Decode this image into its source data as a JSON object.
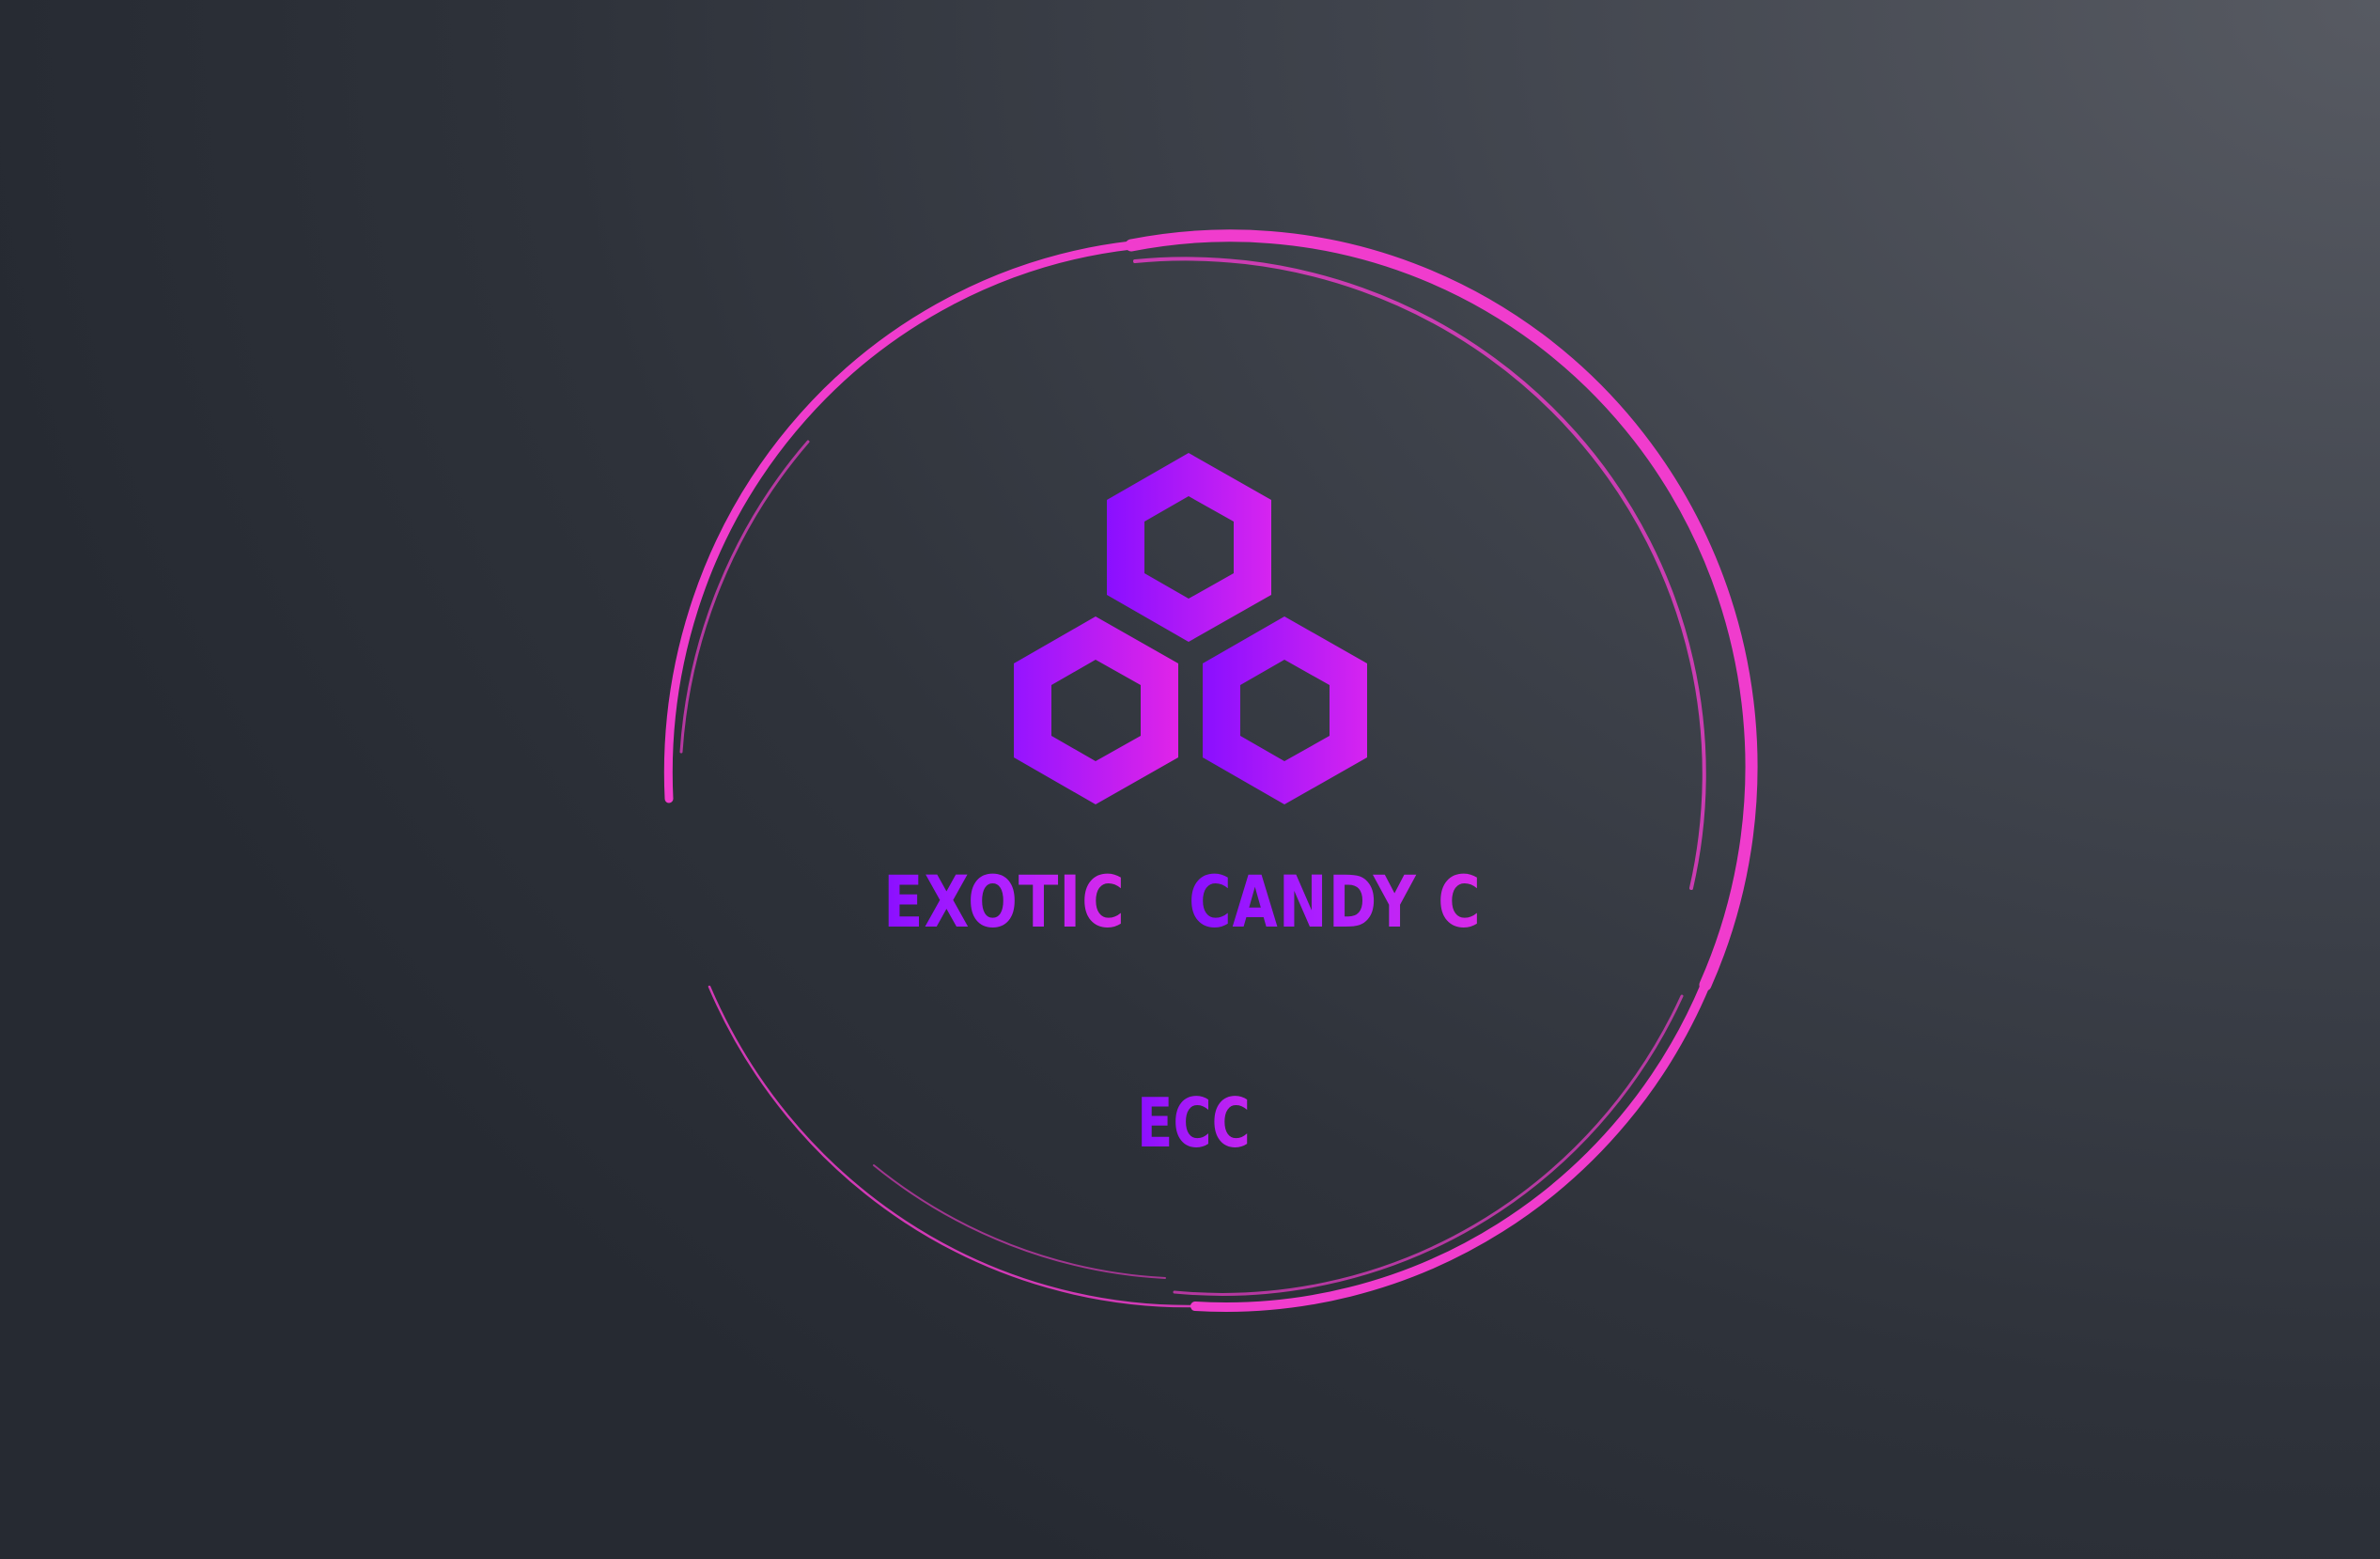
{
  "logo": {
    "name_word_one": "EXOTIC",
    "name_word_two": "CANDY C",
    "initials": "ECC"
  },
  "colors": {
    "background_light": "#575a62",
    "background_dark": "#262a32",
    "ring": "#f03ccd",
    "hexagon_purple": "#8a0fff",
    "hexagon_magenta": "#e022e6",
    "text_purple": "#8a0fff",
    "text_magenta": "#d92ae8"
  },
  "icons": {
    "emblem": "three-hexagons-icon",
    "frame": "brush-ring"
  }
}
